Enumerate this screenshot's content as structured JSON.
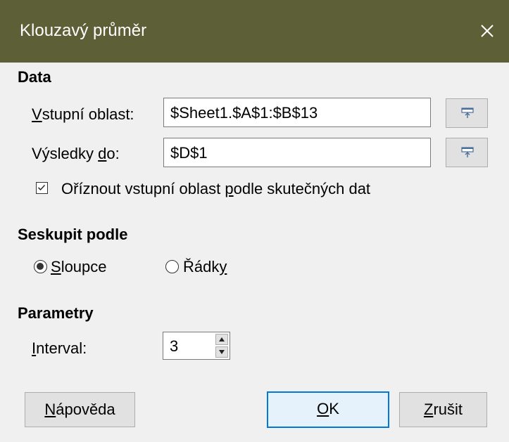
{
  "window": {
    "title": "Klouzavý průměr"
  },
  "data_section": {
    "heading": "Data",
    "input_range": {
      "label_u": "V",
      "label_rest": "stupní oblast:",
      "value": "$Sheet1.$A$1:$B$13"
    },
    "results_to": {
      "label_pre": "Výsledky ",
      "label_u": "d",
      "label_post": "o:",
      "value": "$D$1"
    },
    "trim_checkbox": {
      "label_pre": "Oříznout vstupní oblast ",
      "label_u": "p",
      "label_post": "odle skutečných dat",
      "checked": true
    }
  },
  "group_by": {
    "heading": "Seskupit podle",
    "columns": {
      "label_u": "S",
      "label_rest": "loupce",
      "selected": true
    },
    "rows": {
      "label_pre": "Řádk",
      "label_u": "y",
      "selected": false
    }
  },
  "parameters": {
    "heading": "Parametry",
    "interval": {
      "label_u": "I",
      "label_rest": "nterval:",
      "value": "3"
    }
  },
  "buttons": {
    "help": {
      "label_u": "N",
      "label_rest": "ápověda"
    },
    "ok": {
      "label_u": "O",
      "label_rest": "K"
    },
    "cancel": {
      "label_u": "Z",
      "label_rest": "rušit"
    }
  },
  "colors": {
    "titlebar": "#5d5f36",
    "dialog_bg": "#f0f0f0",
    "default_button_border": "#0078d7"
  }
}
